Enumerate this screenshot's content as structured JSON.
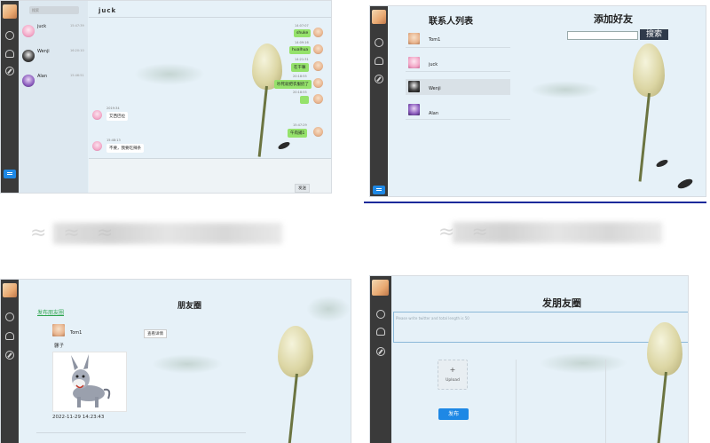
{
  "chat": {
    "header_name": "juck",
    "search_placeholder": "搜索",
    "contacts": [
      {
        "name": "juck",
        "time": "15:47:39"
      },
      {
        "name": "Wenji",
        "time": "16:20:10"
      },
      {
        "name": "Alan",
        "time": "15:46:51"
      }
    ],
    "messages": [
      {
        "side": "me",
        "time": "14:07:07",
        "text": "shuke"
      },
      {
        "side": "me",
        "time": "14:09:16",
        "text": "hualhua"
      },
      {
        "side": "me",
        "time": "14:21:31",
        "text": "在干嘛"
      },
      {
        "side": "me",
        "time": "20:18:55",
        "text": "吵死就把衣服扔了"
      },
      {
        "side": "me",
        "time": "20:18:55",
        "text": ""
      },
      {
        "side": "you",
        "time": "2019:34",
        "text": "艾西巴拉"
      },
      {
        "side": "me",
        "time": "15:47:29",
        "text": "午肉捕1"
      },
      {
        "side": "you",
        "time": "15:48:13",
        "text": "不要，我要吃辣条"
      }
    ],
    "send_button": "发送"
  },
  "contacts_panel": {
    "title": "联系人列表",
    "add_friend_title": "添加好友",
    "search_button": "搜索",
    "search_value": "",
    "list": [
      "Tom1",
      "juck",
      "Wenji",
      "Alan"
    ]
  },
  "moments": {
    "title": "朋友圈",
    "post_link": "发布朋友圈",
    "author": "Tom1",
    "details_button": "查看详情",
    "caption": "骡子",
    "timestamp": "2022-11-29 14:23:43"
  },
  "post": {
    "title": "发朋友圈",
    "textarea_placeholder": "Please write twitter and total length is 50",
    "upload_label": "Upload",
    "upload_plus": "+",
    "publish_button": "发布"
  },
  "colors": {
    "accent": "#1e88e5",
    "panel_bg": "#e6f1f8",
    "rail": "#3a3a3a",
    "bubble_me": "#95e26b",
    "link_green": "#2da44e"
  }
}
